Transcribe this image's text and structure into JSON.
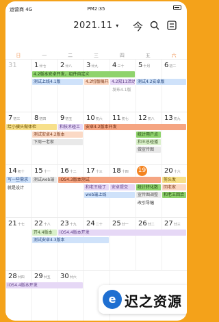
{
  "status": {
    "carrier": "运营商 4G",
    "time": "PM2:35"
  },
  "header": {
    "month": "2021.11",
    "caret": "▾",
    "today_icon": "今",
    "search_icon": "search-icon",
    "more_icon": "more-icon"
  },
  "weekdays": [
    "日",
    "一",
    "二",
    "三",
    "四",
    "五",
    "六"
  ],
  "weeks": [
    {
      "days": [
        {
          "num": "31",
          "sub": "",
          "dim": true
        },
        {
          "num": "1",
          "sub": "廿七"
        },
        {
          "num": "2",
          "sub": "廿八"
        },
        {
          "num": "3",
          "sub": "廿九"
        },
        {
          "num": "4",
          "sub": "三十"
        },
        {
          "num": "5",
          "sub": "十月"
        },
        {
          "num": "6",
          "sub": "初二"
        }
      ],
      "events": {
        "e1": "4.2版本安卓开发，组件自定义",
        "e2": "测试上线4.1版",
        "e3": "4.2切版稿开发",
        "e4": "4.2双11活动开发",
        "e5": "测试4.2安卓版",
        "e6": "发布4.1版"
      }
    },
    {
      "days": [
        {
          "num": "7",
          "sub": "初三"
        },
        {
          "num": "8",
          "sub": "初四"
        },
        {
          "num": "9",
          "sub": "初五"
        },
        {
          "num": "10",
          "sub": "初六"
        },
        {
          "num": "11",
          "sub": "初七"
        },
        {
          "num": "12",
          "sub": "初八"
        },
        {
          "num": "13",
          "sub": "初九"
        }
      ],
      "events": {
        "e1": "给小骥头做体检",
        "e2": "测试安卓4.2版本",
        "e3": "下周一老家",
        "e4": "和技术碰工",
        "e5": "安卓4.2版本开发",
        "e6": "统计用户点",
        "e7": "和王总碰播",
        "e8": "做宣传图"
      }
    },
    {
      "days": [
        {
          "num": "14",
          "sub": "初十"
        },
        {
          "num": "15",
          "sub": "十一"
        },
        {
          "num": "16",
          "sub": "十二"
        },
        {
          "num": "17",
          "sub": "十三"
        },
        {
          "num": "18",
          "sub": "十四"
        },
        {
          "num": "19",
          "sub": "",
          "today": true
        },
        {
          "num": "20",
          "sub": "十六"
        }
      ],
      "events": {
        "e1": "写一些需求",
        "e2": "就是设计",
        "e3": "测试web端",
        "e4": "iOS4.3版本测试",
        "e5": "和老王碰丁",
        "e6": "安卓提交",
        "e7": "web端上线",
        "e8": "统计转化数",
        "e9": "宣传图调整",
        "e10": "改引导幅",
        "e11": "剪头发",
        "e12": "回老家",
        "e13": "和老王回洽"
      }
    },
    {
      "days": [
        {
          "num": "21",
          "sub": "十七"
        },
        {
          "num": "22",
          "sub": "十八"
        },
        {
          "num": "23",
          "sub": "十九"
        },
        {
          "num": "24",
          "sub": "二十"
        },
        {
          "num": "25",
          "sub": "廿一"
        },
        {
          "num": "26",
          "sub": "廿二"
        },
        {
          "num": "27",
          "sub": "廿三"
        }
      ],
      "events": {
        "e1": "开4.4版本",
        "e2": "iOS4.4版本开发",
        "e3": "测试安卓4.3版本"
      }
    },
    {
      "days": [
        {
          "num": "28",
          "sub": "廿四"
        },
        {
          "num": "29",
          "sub": "廿五"
        },
        {
          "num": "30",
          "sub": "廿六"
        }
      ],
      "events": {
        "e1": "iOS4.4版本开发"
      }
    }
  ],
  "watermark": {
    "logo": "e",
    "text": "迟之资源"
  }
}
